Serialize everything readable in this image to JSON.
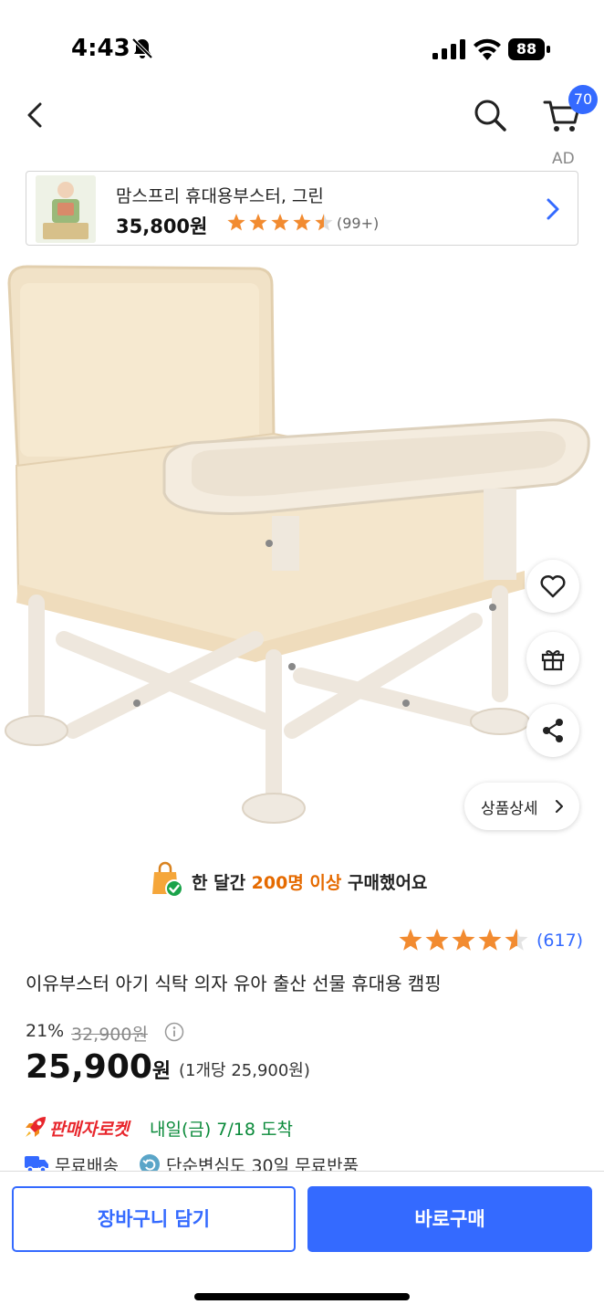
{
  "status_bar": {
    "time": "4:43",
    "battery": "88"
  },
  "nav": {
    "cart_badge": "70"
  },
  "ad": {
    "label": "AD",
    "title": "맘스프리 휴대용부스터, 그린",
    "price": "35,800원",
    "rating": 4.5,
    "review_count": "(99+)"
  },
  "product": {
    "detail_button": "상품상세",
    "notice_prefix": "한 달간 ",
    "notice_highlight": "200명 이상",
    "notice_suffix": " 구매했어요",
    "rating": 4.5,
    "review_count": "(617)",
    "title": "이유부스터 아기 식탁 의자 유아 출산 선물 휴대용 캠핑",
    "discount": "21%",
    "original_price": "32,900원",
    "price": "25,900",
    "price_unit": "원",
    "unit_price": "(1개당 25,900원)",
    "rocket_label": "판매자로켓",
    "delivery": "내일(금) 7/18 도착",
    "free_shipping": "무료배송",
    "free_return": "단순변심도 30일 무료반품"
  },
  "actions": {
    "add_to_cart": "장바구니 담기",
    "buy_now": "바로구매"
  },
  "colors": {
    "accent": "#346aff",
    "star": "#f28b30",
    "highlight": "#e56a00",
    "rocket": "#e8262c",
    "delivery": "#0a8a3a"
  }
}
